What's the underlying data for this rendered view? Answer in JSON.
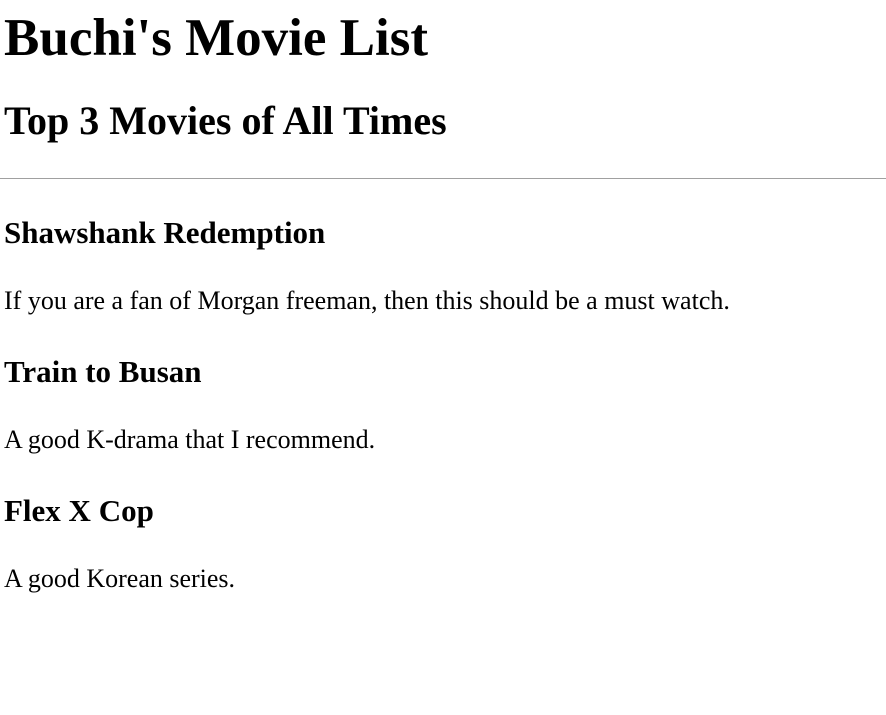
{
  "page": {
    "title": "Buchi's Movie List",
    "subtitle": "Top 3 Movies of All Times"
  },
  "movies": [
    {
      "title": "Shawshank Redemption",
      "description": "If you are a fan of Morgan freeman, then this should be a must watch."
    },
    {
      "title": "Train to Busan",
      "description": "A good K-drama that I recommend."
    },
    {
      "title": "Flex X Cop",
      "description": "A good Korean series."
    }
  ]
}
